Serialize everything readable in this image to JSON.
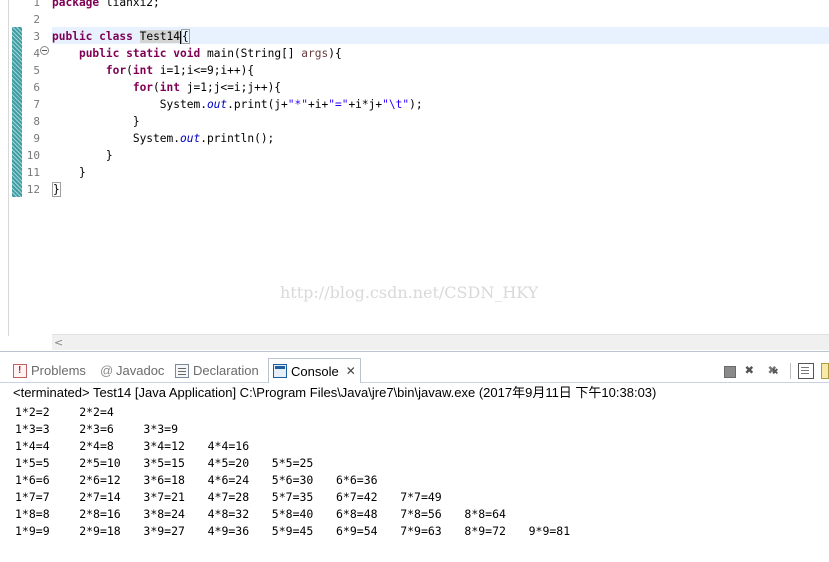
{
  "editor": {
    "line_numbers": [
      "1",
      "2",
      "3",
      "4",
      "5",
      "6",
      "7",
      "8",
      "9",
      "10",
      "11",
      "12"
    ],
    "line1": {
      "kw": "package",
      "rest": " lianxi2;"
    },
    "line3": {
      "kw1": "public",
      "kw2": "class",
      "cls": "Test14",
      "brace": "{"
    },
    "line4": {
      "kw1": "public",
      "kw2": "static",
      "kw3": "void",
      "rest1": " main(String[] ",
      "arg": "args",
      "rest2": "){"
    },
    "line5": {
      "kw": "for",
      "p1": "(",
      "kw2": "int",
      "rest": " i=1;i<=9;i++){"
    },
    "line6": {
      "kw": "for",
      "p1": "(",
      "kw2": "int",
      "rest": " j=1;j<=i;j++){"
    },
    "line7": {
      "a": "System.",
      "f": "out",
      "b": ".print(j+",
      "s1": "\"*\"",
      "c": "+i+",
      "s2": "\"=\"",
      "d": "+i*j+",
      "s3": "\"\\t\"",
      "e": ");"
    },
    "line8": "}",
    "line9": {
      "a": "System.",
      "f": "out",
      "b": ".println();"
    },
    "line10": "}",
    "line11": "}",
    "line12": "}",
    "watermark": "http://blog.csdn.net/CSDN_HKY",
    "scroll_left": "<"
  },
  "tabs": {
    "problems": "Problems",
    "javadoc": "Javadoc",
    "javadoc_icon": "@",
    "declaration": "Declaration",
    "console": "Console",
    "console_close": "✕"
  },
  "console": {
    "status": "<terminated> Test14 [Java Application] C:\\Program Files\\Java\\jre7\\bin\\javaw.exe (2017年9月11日 下午10:38:03)",
    "rows": [
      [
        "1*2=2",
        "2*2=4"
      ],
      [
        "1*3=3",
        "2*3=6",
        "3*3=9"
      ],
      [
        "1*4=4",
        "2*4=8",
        "3*4=12",
        "4*4=16"
      ],
      [
        "1*5=5",
        "2*5=10",
        "3*5=15",
        "4*5=20",
        "5*5=25"
      ],
      [
        "1*6=6",
        "2*6=12",
        "3*6=18",
        "4*6=24",
        "5*6=30",
        "6*6=36"
      ],
      [
        "1*7=7",
        "2*7=14",
        "3*7=21",
        "4*7=28",
        "5*7=35",
        "6*7=42",
        "7*7=49"
      ],
      [
        "1*8=8",
        "2*8=16",
        "3*8=24",
        "4*8=32",
        "5*8=40",
        "6*8=48",
        "7*8=56",
        "8*8=64"
      ],
      [
        "1*9=9",
        "2*9=18",
        "3*9=27",
        "4*9=36",
        "5*9=45",
        "6*9=54",
        "7*9=63",
        "8*9=72",
        "9*9=81"
      ]
    ]
  }
}
